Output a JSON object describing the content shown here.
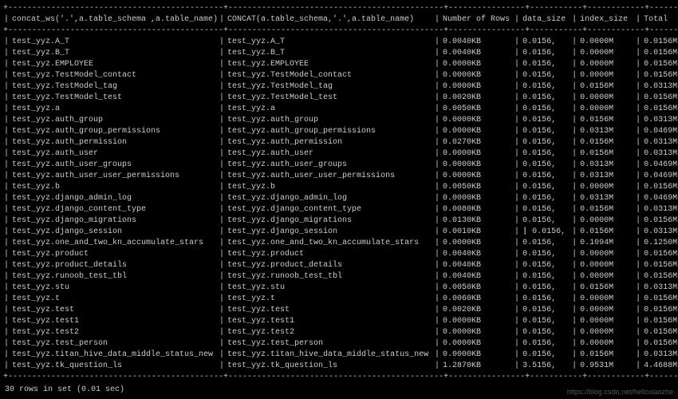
{
  "headers": {
    "col1": "concat_ws('.',a.table_schema ,a.table_name)",
    "col2": "CONCAT(a.table_schema,'.',a.table_name)",
    "col3": "Number of Rows",
    "col4": "data_size",
    "col5": "index_size",
    "col6": "Total"
  },
  "rows": [
    {
      "c1": "test_yyz.A_T",
      "c2": "test_yyz.A_T",
      "c3": "0.0040KB",
      "c4": "0.0156,",
      "c5": "0.0000M",
      "c6": "0.0156M"
    },
    {
      "c1": "test_yyz.B_T",
      "c2": "test_yyz.B_T",
      "c3": "0.0040KB",
      "c4": "0.0156,",
      "c5": "0.0000M",
      "c6": "0.0156M"
    },
    {
      "c1": "test_yyz.EMPLOYEE",
      "c2": "test_yyz.EMPLOYEE",
      "c3": "0.0000KB",
      "c4": "0.0156,",
      "c5": "0.0000M",
      "c6": "0.0156M"
    },
    {
      "c1": "test_yyz.TestModel_contact",
      "c2": "test_yyz.TestModel_contact",
      "c3": "0.0000KB",
      "c4": "0.0156,",
      "c5": "0.0000M",
      "c6": "0.0156M"
    },
    {
      "c1": "test_yyz.TestModel_tag",
      "c2": "test_yyz.TestModel_tag",
      "c3": "0.0000KB",
      "c4": "0.0156,",
      "c5": "0.0156M",
      "c6": "0.0313M"
    },
    {
      "c1": "test_yyz.TestModel_test",
      "c2": "test_yyz.TestModel_test",
      "c3": "0.0020KB",
      "c4": "0.0156,",
      "c5": "0.0000M",
      "c6": "0.0156M"
    },
    {
      "c1": "test_yyz.a",
      "c2": "test_yyz.a",
      "c3": "0.0050KB",
      "c4": "0.0156,",
      "c5": "0.0000M",
      "c6": "0.0156M"
    },
    {
      "c1": "test_yyz.auth_group",
      "c2": "test_yyz.auth_group",
      "c3": "0.0000KB",
      "c4": "0.0156,",
      "c5": "0.0156M",
      "c6": "0.0313M"
    },
    {
      "c1": "test_yyz.auth_group_permissions",
      "c2": "test_yyz.auth_group_permissions",
      "c3": "0.0000KB",
      "c4": "0.0156,",
      "c5": "0.0313M",
      "c6": "0.0469M"
    },
    {
      "c1": "test_yyz.auth_permission",
      "c2": "test_yyz.auth_permission",
      "c3": "0.0270KB",
      "c4": "0.0156,",
      "c5": "0.0156M",
      "c6": "0.0313M"
    },
    {
      "c1": "test_yyz.auth_user",
      "c2": "test_yyz.auth_user",
      "c3": "0.0000KB",
      "c4": "0.0156,",
      "c5": "0.0156M",
      "c6": "0.0313M"
    },
    {
      "c1": "test_yyz.auth_user_groups",
      "c2": "test_yyz.auth_user_groups",
      "c3": "0.0000KB",
      "c4": "0.0156,",
      "c5": "0.0313M",
      "c6": "0.0469M"
    },
    {
      "c1": "test_yyz.auth_user_user_permissions",
      "c2": "test_yyz.auth_user_user_permissions",
      "c3": "0.0000KB",
      "c4": "0.0156,",
      "c5": "0.0313M",
      "c6": "0.0469M"
    },
    {
      "c1": "test_yyz.b",
      "c2": "test_yyz.b",
      "c3": "0.0050KB",
      "c4": "0.0156,",
      "c5": "0.0000M",
      "c6": "0.0156M"
    },
    {
      "c1": "test_yyz.django_admin_log",
      "c2": "test_yyz.django_admin_log",
      "c3": "0.0000KB",
      "c4": "0.0156,",
      "c5": "0.0313M",
      "c6": "0.0469M"
    },
    {
      "c1": "test_yyz.django_content_type",
      "c2": "test_yyz.django_content_type",
      "c3": "0.0080KB",
      "c4": "0.0156,",
      "c5": "0.0156M",
      "c6": "0.0313M"
    },
    {
      "c1": "test_yyz.django_migrations",
      "c2": "test_yyz.django_migrations",
      "c3": "0.0130KB",
      "c4": "0.0156,",
      "c5": "0.0000M",
      "c6": "0.0156M"
    },
    {
      "c1": "test_yyz.django_session",
      "c2": "test_yyz.django_session",
      "c3": "0.0010KB",
      "c4": "0.0156,",
      "c5": "0.0156M",
      "c6": "0.0313M",
      "anom": true
    },
    {
      "c1": "test_yyz.one_and_two_kn_accumulate_stars",
      "c2": "test_yyz.one_and_two_kn_accumulate_stars",
      "c3": "0.0000KB",
      "c4": "0.0156,",
      "c5": "0.1094M",
      "c6": "0.1250M"
    },
    {
      "c1": "test_yyz.product",
      "c2": "test_yyz.product",
      "c3": "0.0040KB",
      "c4": "0.0156,",
      "c5": "0.0000M",
      "c6": "0.0156M"
    },
    {
      "c1": "test_yyz.product_details",
      "c2": "test_yyz.product_details",
      "c3": "0.0040KB",
      "c4": "0.0156,",
      "c5": "0.0000M",
      "c6": "0.0156M"
    },
    {
      "c1": "test_yyz.runoob_test_tbl",
      "c2": "test_yyz.runoob_test_tbl",
      "c3": "0.0040KB",
      "c4": "0.0156,",
      "c5": "0.0000M",
      "c6": "0.0156M"
    },
    {
      "c1": "test_yyz.stu",
      "c2": "test_yyz.stu",
      "c3": "0.0050KB",
      "c4": "0.0156,",
      "c5": "0.0156M",
      "c6": "0.0313M"
    },
    {
      "c1": "test_yyz.t",
      "c2": "test_yyz.t",
      "c3": "0.0060KB",
      "c4": "0.0156,",
      "c5": "0.0000M",
      "c6": "0.0156M"
    },
    {
      "c1": "test_yyz.test",
      "c2": "test_yyz.test",
      "c3": "0.0020KB",
      "c4": "0.0156,",
      "c5": "0.0000M",
      "c6": "0.0156M"
    },
    {
      "c1": "test_yyz.test1",
      "c2": "test_yyz.test1",
      "c3": "0.0000KB",
      "c4": "0.0156,",
      "c5": "0.0000M",
      "c6": "0.0156M"
    },
    {
      "c1": "test_yyz.test2",
      "c2": "test_yyz.test2",
      "c3": "0.0000KB",
      "c4": "0.0156,",
      "c5": "0.0000M",
      "c6": "0.0156M"
    },
    {
      "c1": "test_yyz.test_person",
      "c2": "test_yyz.test_person",
      "c3": "0.0000KB",
      "c4": "0.0156,",
      "c5": "0.0000M",
      "c6": "0.0156M"
    },
    {
      "c1": "test_yyz.titan_hive_data_middle_status_new",
      "c2": "test_yyz.titan_hive_data_middle_status_new",
      "c3": "0.0000KB",
      "c4": "0.0156,",
      "c5": "0.0156M",
      "c6": "0.0313M"
    },
    {
      "c1": "test_yyz.tk_question_ls",
      "c2": "test_yyz.tk_question_ls",
      "c3": "1.2870KB",
      "c4": "3.5156,",
      "c5": "0.9531M",
      "c6": "4.4688M"
    }
  ],
  "footer": "30 rows in set (0.01 sec)",
  "watermark": "https://blog.csdn.net/helloxiaozhe"
}
